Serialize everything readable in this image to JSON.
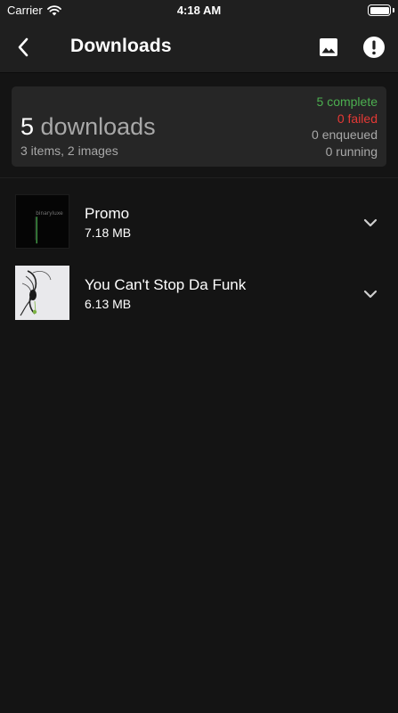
{
  "status_bar": {
    "carrier": "Carrier",
    "time": "4:18 AM",
    "battery_level": 1.0
  },
  "nav": {
    "title": "Downloads",
    "back_icon": "chevron-left-icon",
    "images_icon": "image-icon",
    "alert_icon": "alert-circle-icon"
  },
  "summary": {
    "count": "5",
    "count_word": "downloads",
    "subtitle": "3 items, 2 images",
    "complete": "5 complete",
    "failed": "0 failed",
    "enqueued": "0 enqueued",
    "running": "0 running"
  },
  "downloads": [
    {
      "title": "Promo",
      "size": "7.18 MB",
      "artwork_text": "binaryluxe"
    },
    {
      "title": "You Can't Stop Da Funk",
      "size": "6.13 MB"
    }
  ],
  "colors": {
    "background": "#141414",
    "bar": "#1f1f1f",
    "card": "#262626",
    "complete": "#4caf50",
    "failed": "#e53935",
    "muted": "#a8a8a8"
  }
}
